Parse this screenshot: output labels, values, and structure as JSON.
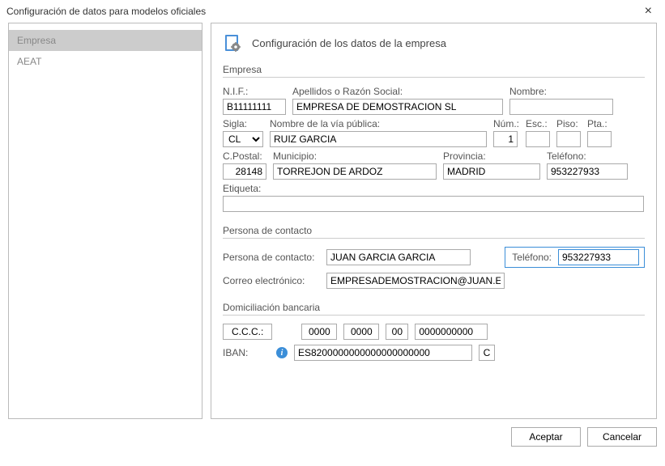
{
  "window": {
    "title": "Configuración de datos para modelos oficiales"
  },
  "sidebar": {
    "items": [
      {
        "label": "Empresa",
        "selected": true
      },
      {
        "label": "AEAT",
        "selected": false
      }
    ]
  },
  "heading": "Configuración de los datos de la empresa",
  "sections": {
    "empresa": "Empresa",
    "contacto": "Persona de contacto",
    "banco": "Domiciliación bancaria"
  },
  "labels": {
    "nif": "N.I.F.:",
    "razon": "Apellidos o Razón Social:",
    "nombre": "Nombre:",
    "sigla": "Sigla:",
    "via": "Nombre de la vía pública:",
    "num": "Núm.:",
    "esc": "Esc.:",
    "piso": "Piso:",
    "pta": "Pta.:",
    "cpostal": "C.Postal:",
    "municipio": "Municipio:",
    "provincia": "Provincia:",
    "telefono": "Teléfono:",
    "etiqueta": "Etiqueta:",
    "persona_contacto": "Persona de contacto:",
    "correo": "Correo electrónico:",
    "ccc": "C.C.C.:",
    "iban": "IBAN:",
    "iban_btn": "C"
  },
  "values": {
    "nif": "B11111111",
    "razon": "EMPRESA DE DEMOSTRACION SL",
    "nombre": "",
    "sigla": "CL",
    "via": "RUIZ GARCIA",
    "num": "1",
    "esc": "",
    "piso": "",
    "pta": "",
    "cpostal": "28148",
    "municipio": "TORREJON DE ARDOZ",
    "provincia": "MADRID",
    "telefono": "953227933",
    "etiqueta": "",
    "persona_contacto": "JUAN GARCIA GARCIA",
    "contacto_telefono": "953227933",
    "correo": "EMPRESADEMOSTRACION@JUAN.ES",
    "ccc1": "0000",
    "ccc2": "0000",
    "ccc3": "00",
    "ccc4": "0000000000",
    "iban": "ES8200000000000000000000"
  },
  "buttons": {
    "accept": "Aceptar",
    "cancel": "Cancelar"
  }
}
